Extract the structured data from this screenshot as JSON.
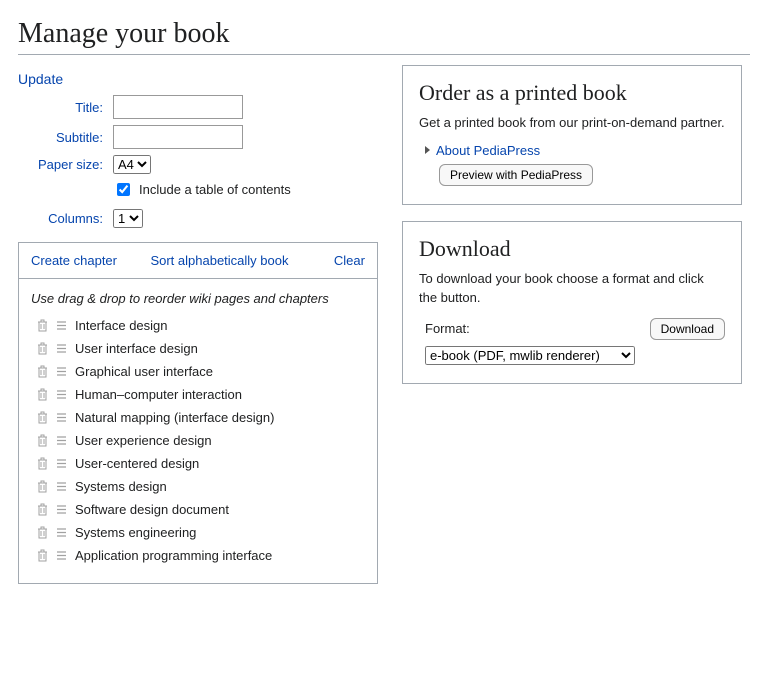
{
  "page_title": "Manage your book",
  "update": {
    "heading": "Update",
    "title_label": "Title:",
    "title_value": "",
    "subtitle_label": "Subtitle:",
    "subtitle_value": "",
    "paper_label": "Paper size:",
    "paper_selected": "A4",
    "toc_label": "Include a table of contents",
    "toc_checked": true,
    "columns_label": "Columns:",
    "columns_selected": "1"
  },
  "actions": {
    "create_chapter": "Create chapter",
    "sort_alpha": "Sort alphabetically book",
    "clear": "Clear"
  },
  "list": {
    "hint": "Use drag & drop to reorder wiki pages and chapters",
    "items": [
      "Interface design",
      "User interface design",
      "Graphical user interface",
      "Human–computer interaction",
      "Natural mapping (interface design)",
      "User experience design",
      "User-centered design",
      "Systems design",
      "Software design document",
      "Systems engineering",
      "Application programming interface"
    ]
  },
  "order_panel": {
    "heading": "Order as a printed book",
    "description": "Get a printed book from our print-on-demand partner.",
    "about_link": "About PediaPress",
    "preview_button": "Preview with PediaPress"
  },
  "download_panel": {
    "heading": "Download",
    "description": "To download your book choose a format and click the button.",
    "format_label": "Format:",
    "format_selected": "e-book (PDF, mwlib renderer)",
    "download_button": "Download"
  }
}
